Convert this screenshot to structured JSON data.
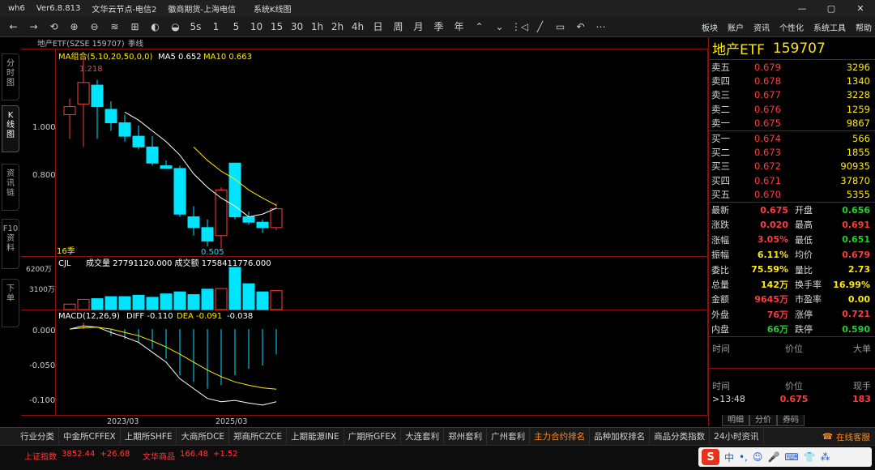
{
  "titlebar": {
    "app": "wh6",
    "version": "Ver6.8.813",
    "node1": "文华云节点-电信2",
    "node2": "徽商期货-上海电信",
    "mode": "系统K线图",
    "min": "—",
    "max": "▢",
    "close": "✕"
  },
  "toolbar": {
    "items": [
      "←",
      "→",
      "⟲",
      "⊕",
      "⊖",
      "≋",
      "⊞",
      "◐",
      "◒",
      "5s",
      "1",
      "5",
      "10",
      "15",
      "30",
      "1h",
      "2h",
      "4h",
      "日",
      "周",
      "月",
      "季",
      "年",
      "⌃",
      "⌄",
      "⋮◁",
      "╱",
      "▭",
      "↶",
      "⋯"
    ],
    "right": [
      "板块",
      "账户",
      "资讯",
      "个性化",
      "系统工具",
      "帮助"
    ]
  },
  "left_tabs": [
    "分\n时\n图",
    "K\n线\n图",
    "资\n讯\n链",
    "F10\n资\n料",
    "下\n单"
  ],
  "chart_header": {
    "symbol": "地产ETF(SZSE 159707)",
    "period": "季线",
    "ma_label": "MA组合(5,10,20,50,0,0)",
    "ma5": "MA5 0.652",
    "ma10": "MA10 0.663",
    "max_label": "1.218",
    "min_label": "0.505",
    "count_label": "16季",
    "ytick_main": [
      "1.000",
      "0.800"
    ],
    "vol_label": "CJL",
    "vol_text": "成交量 27791120.000  成交额 1758411776.000",
    "vol_ticks": [
      "6200万",
      "3100万"
    ],
    "macd_label": "MACD(12,26,9)",
    "diff": "DIFF -0.110",
    "dea": "DEA -0.091",
    "macd_val": "-0.038",
    "macd_ticks": [
      "0.000",
      "-0.050",
      "-0.100"
    ],
    "dates": [
      "2023/03",
      "2025/03"
    ]
  },
  "chart_data": {
    "type": "candlestick",
    "title": "地产ETF(SZSE 159707)",
    "period": "季线",
    "ylim": [
      0.48,
      1.24
    ],
    "candles": [
      {
        "o": 1.0,
        "h": 1.06,
        "l": 0.91,
        "c": 1.03
      },
      {
        "o": 1.04,
        "h": 1.218,
        "l": 0.88,
        "c": 1.12
      },
      {
        "o": 1.11,
        "h": 1.13,
        "l": 0.91,
        "c": 1.03
      },
      {
        "o": 1.02,
        "h": 1.05,
        "l": 0.94,
        "c": 0.97
      },
      {
        "o": 0.97,
        "h": 1.0,
        "l": 0.9,
        "c": 0.92
      },
      {
        "o": 0.92,
        "h": 0.96,
        "l": 0.87,
        "c": 0.88
      },
      {
        "o": 0.88,
        "h": 0.92,
        "l": 0.81,
        "c": 0.82
      },
      {
        "o": 0.81,
        "h": 0.83,
        "l": 0.8,
        "c": 0.8
      },
      {
        "o": 0.8,
        "h": 0.81,
        "l": 0.62,
        "c": 0.63
      },
      {
        "o": 0.62,
        "h": 0.66,
        "l": 0.55,
        "c": 0.58
      },
      {
        "o": 0.58,
        "h": 0.61,
        "l": 0.51,
        "c": 0.53
      },
      {
        "o": 0.55,
        "h": 0.73,
        "l": 0.505,
        "c": 0.72
      },
      {
        "o": 0.82,
        "h": 0.82,
        "l": 0.61,
        "c": 0.62
      },
      {
        "o": 0.62,
        "h": 0.64,
        "l": 0.59,
        "c": 0.6
      },
      {
        "o": 0.6,
        "h": 0.61,
        "l": 0.56,
        "c": 0.58
      },
      {
        "o": 0.58,
        "h": 0.67,
        "l": 0.57,
        "c": 0.65
      }
    ],
    "ma5": [
      null,
      null,
      null,
      null,
      1.01,
      0.98,
      0.94,
      0.9,
      0.85,
      0.78,
      0.73,
      0.69,
      0.66,
      0.62,
      0.63,
      0.652
    ],
    "ma10": [
      null,
      null,
      null,
      null,
      null,
      null,
      null,
      null,
      null,
      0.88,
      0.83,
      0.79,
      0.76,
      0.72,
      0.69,
      0.663
    ],
    "volume": [
      800,
      1500,
      1600,
      1900,
      1900,
      2100,
      1800,
      2300,
      2600,
      2200,
      3000,
      3100,
      6200,
      3800,
      2600,
      2779
    ],
    "volume_ylim": [
      0,
      6200
    ],
    "macd_diff": [
      0.0,
      0.005,
      0.003,
      -0.005,
      -0.012,
      -0.02,
      -0.035,
      -0.05,
      -0.075,
      -0.09,
      -0.105,
      -0.11,
      -0.108,
      -0.112,
      -0.115,
      -0.11
    ],
    "macd_dea": [
      0.0,
      0.002,
      0.003,
      0.0,
      -0.005,
      -0.01,
      -0.018,
      -0.027,
      -0.038,
      -0.05,
      -0.062,
      -0.072,
      -0.08,
      -0.085,
      -0.089,
      -0.091
    ],
    "macd_hist": [
      0.0,
      0.01,
      0.0,
      -0.01,
      -0.015,
      -0.02,
      -0.03,
      -0.045,
      -0.07,
      -0.08,
      -0.09,
      -0.085,
      -0.07,
      -0.06,
      -0.055,
      -0.038
    ],
    "macd_ylim": [
      -0.125,
      0.01
    ]
  },
  "quote": {
    "name": "地产ETF",
    "code": "159707",
    "asks": [
      {
        "label": "卖五",
        "price": "0.679",
        "vol": "3296"
      },
      {
        "label": "卖四",
        "price": "0.678",
        "vol": "1340"
      },
      {
        "label": "卖三",
        "price": "0.677",
        "vol": "3228"
      },
      {
        "label": "卖二",
        "price": "0.676",
        "vol": "1259"
      },
      {
        "label": "卖一",
        "price": "0.675",
        "vol": "9867"
      }
    ],
    "bids": [
      {
        "label": "买一",
        "price": "0.674",
        "vol": "566"
      },
      {
        "label": "买二",
        "price": "0.673",
        "vol": "1855"
      },
      {
        "label": "买三",
        "price": "0.672",
        "vol": "90935"
      },
      {
        "label": "买四",
        "price": "0.671",
        "vol": "37870"
      },
      {
        "label": "买五",
        "price": "0.670",
        "vol": "5355"
      }
    ],
    "stats": [
      {
        "k1": "最新",
        "v1": "0.675",
        "c1": "red",
        "k2": "开盘",
        "v2": "0.656",
        "c2": "grn"
      },
      {
        "k1": "涨跌",
        "v1": "0.020",
        "c1": "red",
        "k2": "最高",
        "v2": "0.691",
        "c2": "red"
      },
      {
        "k1": "涨幅",
        "v1": "3.05%",
        "c1": "red",
        "k2": "最低",
        "v2": "0.651",
        "c2": "grn"
      },
      {
        "k1": "振幅",
        "v1": "6.11%",
        "c1": "yel",
        "k2": "均价",
        "v2": "0.679",
        "c2": "red"
      },
      {
        "k1": "委比",
        "v1": "75.59%",
        "c1": "yel",
        "k2": "量比",
        "v2": "2.73",
        "c2": "yel"
      },
      {
        "k1": "总量",
        "v1": "142万",
        "c1": "yel",
        "k2": "换手率",
        "v2": "16.99%",
        "c2": "yel"
      },
      {
        "k1": "金额",
        "v1": "9645万",
        "c1": "red",
        "k2": "市盈率",
        "v2": "0.00",
        "c2": "yel"
      },
      {
        "k1": "外盘",
        "v1": "76万",
        "c1": "red",
        "k2": "涨停",
        "v2": "0.721",
        "c2": "red"
      },
      {
        "k1": "内盘",
        "v1": "66万",
        "c1": "grn",
        "k2": "跌停",
        "v2": "0.590",
        "c2": "grn"
      }
    ],
    "big_hdr": [
      "时间",
      "价位",
      "大单"
    ],
    "tick_hdr": [
      "时间",
      "价位",
      "现手"
    ],
    "tick_row": {
      "time": ">13:48",
      "price": "0.675",
      "vol": "183"
    },
    "tabs": [
      "明细",
      "分价",
      "券码"
    ]
  },
  "bottom_tabs": [
    "行业分类",
    "中金所CFFEX",
    "上期所SHFE",
    "大商所DCE",
    "郑商所CZCE",
    "上期能源INE",
    "广期所GFEX",
    "大连套利",
    "郑州套利",
    "广州套利",
    "主力合约排名",
    "品种加权排名",
    "商品分类指数",
    "24小时资讯"
  ],
  "bottom_active": 10,
  "service": "在线客服",
  "status": {
    "idx1_name": "上证指数",
    "idx1_val": "3852.44",
    "idx1_chg": "+26.68",
    "idx2_name": "文华商品",
    "idx2_val": "166.48",
    "idx2_chg": "+1.52"
  },
  "ime": {
    "logo": "S",
    "lang": "中"
  },
  "colors": {
    "up": "#ff3b3b",
    "down": "#00e5ff",
    "ma5": "#ffffff",
    "ma10": "#ffea00",
    "accent": "#8a1010"
  }
}
